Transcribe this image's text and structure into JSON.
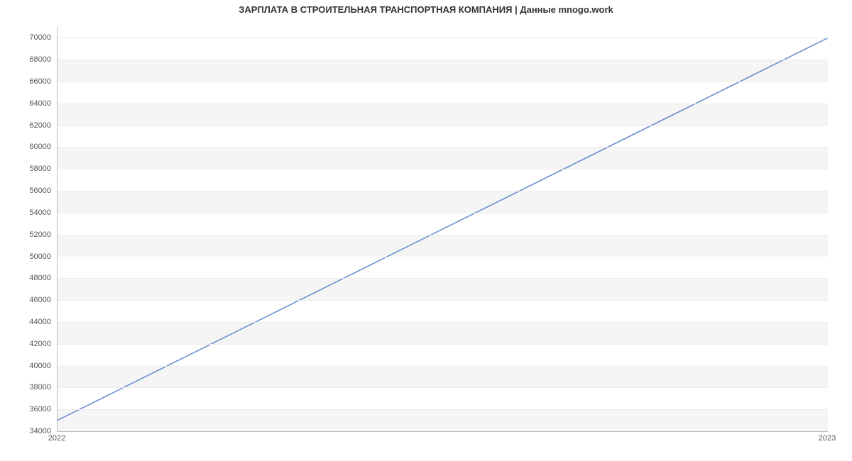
{
  "chart_data": {
    "type": "line",
    "title": "ЗАРПЛАТА В  СТРОИТЕЛЬНАЯ ТРАНСПОРТНАЯ КОМПАНИЯ | Данные mnogo.work",
    "x": [
      2022,
      2023
    ],
    "values": [
      35000,
      70000
    ],
    "xlabel": "",
    "ylabel": "",
    "xlim": [
      2022,
      2023
    ],
    "ylim": [
      34000,
      71000
    ],
    "x_ticks": [
      2022,
      2023
    ],
    "y_ticks": [
      34000,
      36000,
      38000,
      40000,
      42000,
      44000,
      46000,
      48000,
      50000,
      52000,
      54000,
      56000,
      58000,
      60000,
      62000,
      64000,
      66000,
      68000,
      70000
    ],
    "line_color": "#6b8fcf",
    "band_color": "#f5f5f5",
    "grid_on": true
  }
}
